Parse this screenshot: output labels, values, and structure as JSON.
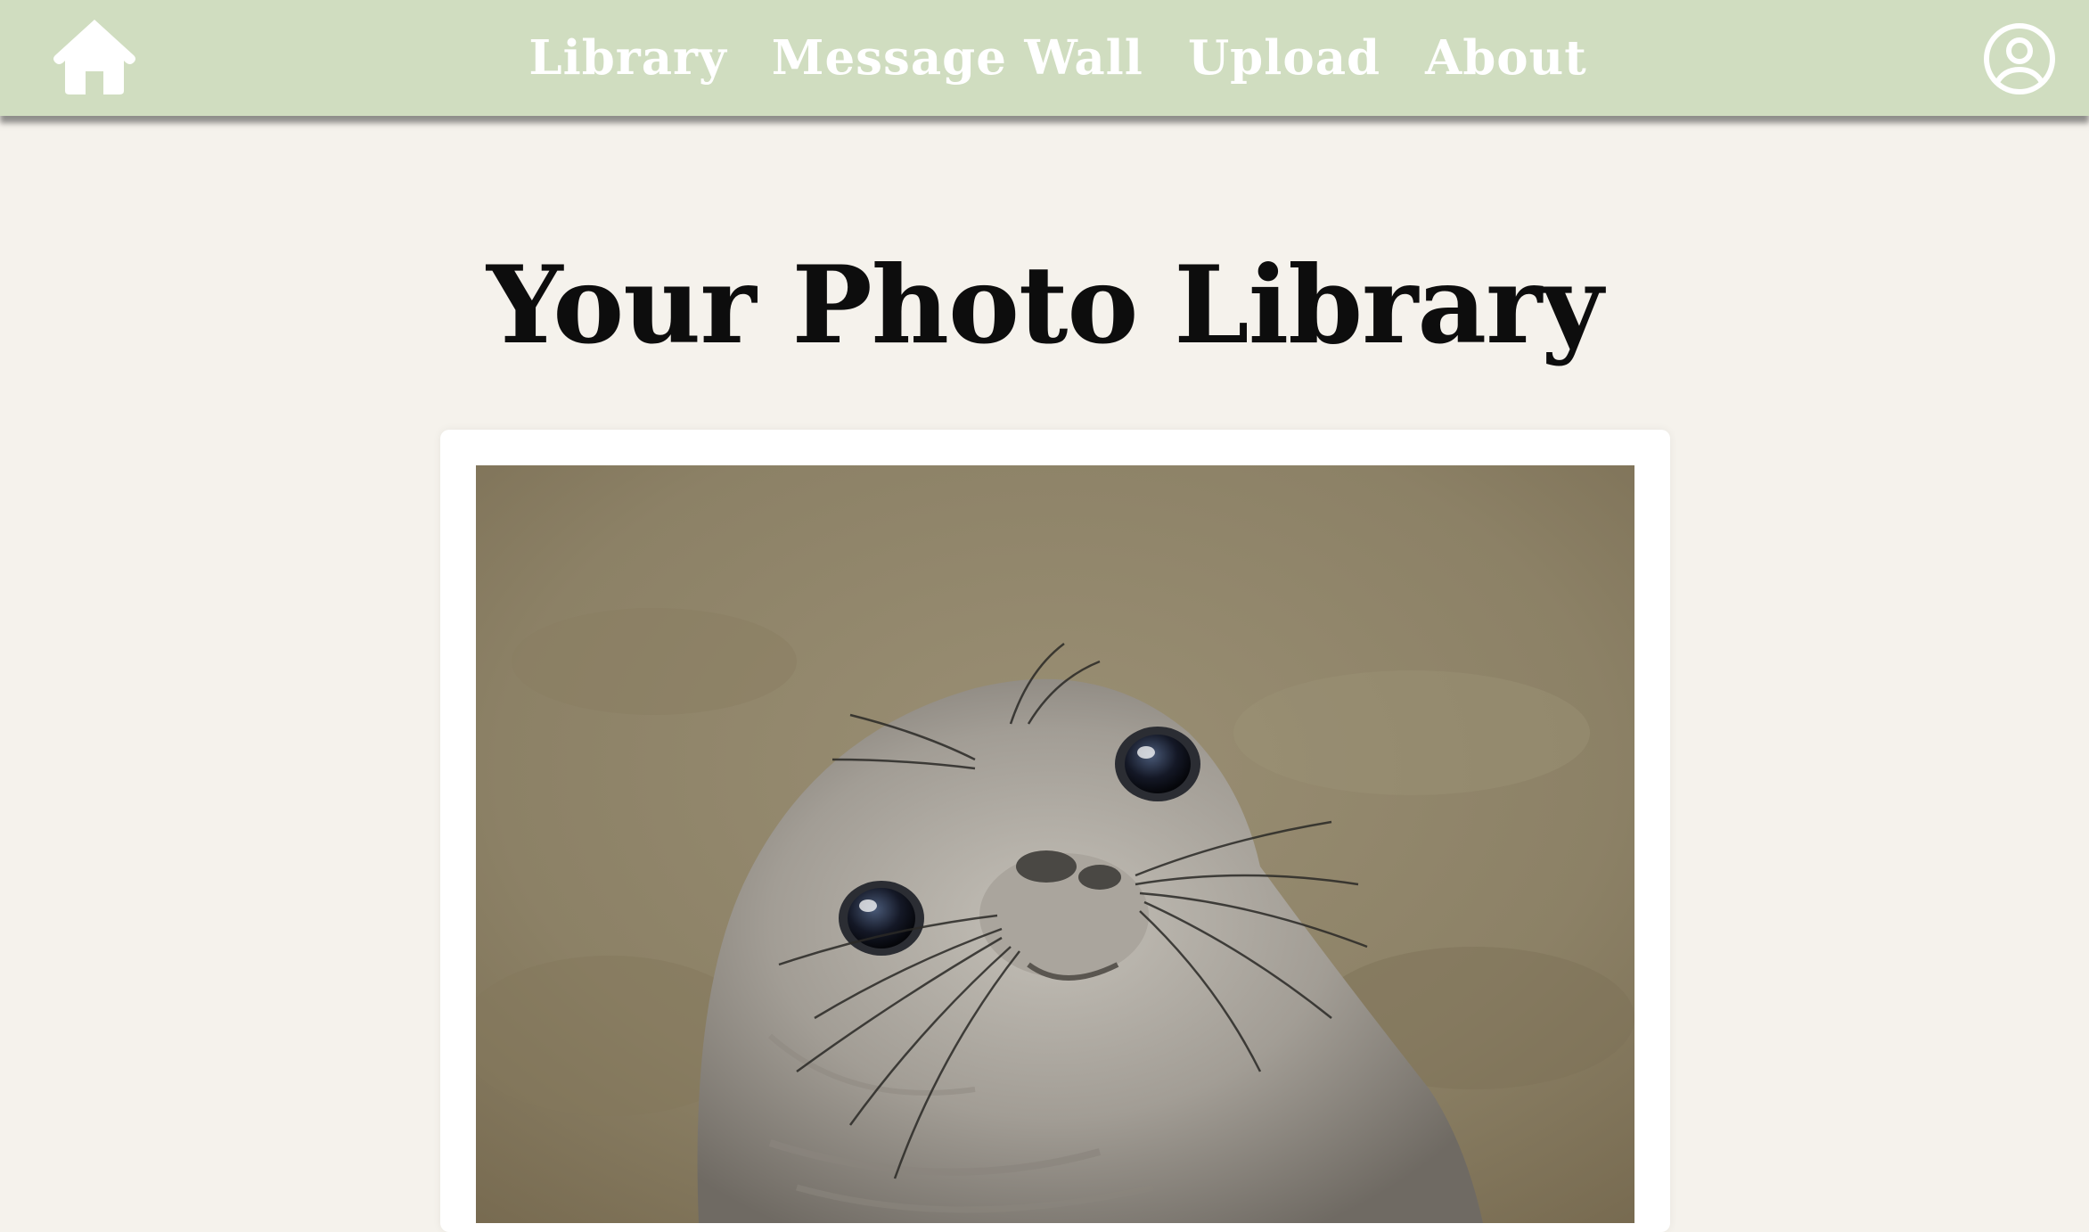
{
  "nav": {
    "home_icon": "home-icon",
    "links": [
      {
        "label": "Library"
      },
      {
        "label": "Message Wall"
      },
      {
        "label": "Upload"
      },
      {
        "label": "About"
      }
    ],
    "profile_icon": "user-circle-icon",
    "colors": {
      "bar": "#d0ddc0",
      "text": "#ffffff"
    }
  },
  "main": {
    "title": "Your Photo Library"
  },
  "colors": {
    "background": "#f5f2ec",
    "card": "#ffffff"
  }
}
